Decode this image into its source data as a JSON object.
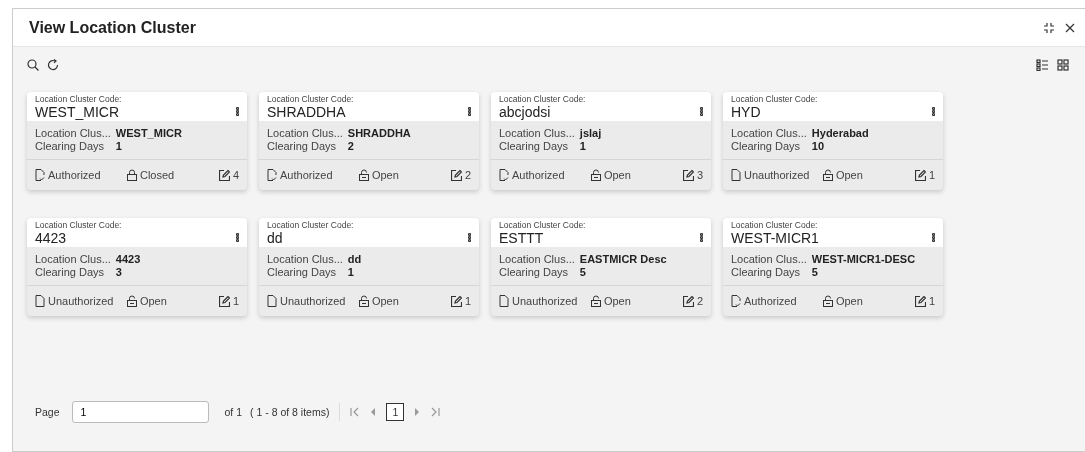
{
  "window": {
    "title": "View Location Cluster"
  },
  "cards": [
    {
      "code_label": "Location Cluster Code:",
      "code": "WEST_MICR",
      "desc_label": "Location Clus...",
      "desc": "WEST_MICR",
      "days_label": "Clearing Days",
      "days": "1",
      "authorized": true,
      "status": "Authorized",
      "locked": true,
      "lock": "Closed",
      "edits": "4"
    },
    {
      "code_label": "Location Cluster Code:",
      "code": "SHRADDHA",
      "desc_label": "Location Clus...",
      "desc": "SHRADDHA",
      "days_label": "Clearing Days",
      "days": "2",
      "authorized": true,
      "status": "Authorized",
      "locked": false,
      "lock": "Open",
      "edits": "2"
    },
    {
      "code_label": "Location Cluster Code:",
      "code": "abcjodsi",
      "desc_label": "Location Clus...",
      "desc": "jslaj",
      "days_label": "Clearing Days",
      "days": "1",
      "authorized": true,
      "status": "Authorized",
      "locked": false,
      "lock": "Open",
      "edits": "3"
    },
    {
      "code_label": "Location Cluster Code:",
      "code": "HYD",
      "desc_label": "Location Clus...",
      "desc": "Hyderabad",
      "days_label": "Clearing Days",
      "days": "10",
      "authorized": false,
      "status": "Unauthorized",
      "locked": false,
      "lock": "Open",
      "edits": "1"
    },
    {
      "code_label": "Location Cluster Code:",
      "code": "4423",
      "desc_label": "Location Clus...",
      "desc": "4423",
      "days_label": "Clearing Days",
      "days": "3",
      "authorized": false,
      "status": "Unauthorized",
      "locked": false,
      "lock": "Open",
      "edits": "1"
    },
    {
      "code_label": "Location Cluster Code:",
      "code": "dd",
      "desc_label": "Location Clus...",
      "desc": "dd",
      "days_label": "Clearing Days",
      "days": "1",
      "authorized": false,
      "status": "Unauthorized",
      "locked": false,
      "lock": "Open",
      "edits": "1"
    },
    {
      "code_label": "Location Cluster Code:",
      "code": "ESTTT",
      "desc_label": "Location Clus...",
      "desc": "EASTMICR Desc",
      "days_label": "Clearing Days",
      "days": "5",
      "authorized": false,
      "status": "Unauthorized",
      "locked": false,
      "lock": "Open",
      "edits": "2"
    },
    {
      "code_label": "Location Cluster Code:",
      "code": "WEST-MICR1",
      "desc_label": "Location Clus...",
      "desc": "WEST-MICR1-DESC",
      "days_label": "Clearing Days",
      "days": "5",
      "authorized": true,
      "status": "Authorized",
      "locked": false,
      "lock": "Open",
      "edits": "1"
    }
  ],
  "pager": {
    "label": "Page",
    "value": "1",
    "of": "of 1",
    "range": "( 1 - 8 of 8 items)",
    "current": "1"
  }
}
